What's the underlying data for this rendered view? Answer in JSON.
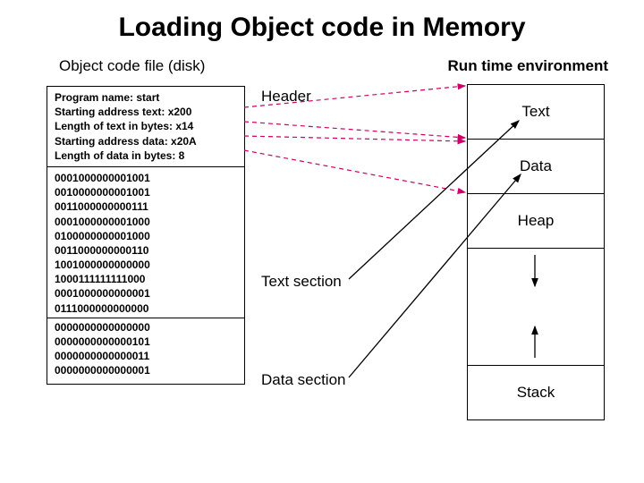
{
  "title": "Loading Object code in Memory",
  "left_heading": "Object code file (disk)",
  "right_heading": "Run time environment",
  "header_fields": {
    "line1": "Program name: start",
    "line2": "Starting address text: x200",
    "line3": "Length of text in bytes: x14",
    "line4": "Starting address data: x20A",
    "line5": "Length of data in bytes: 8"
  },
  "bits": {
    "text_rows": [
      "0001000000001001",
      "0010000000001001",
      "0011000000000111",
      "0001000000001000",
      "0100000000001000",
      "0011000000000110",
      "1001000000000000",
      "1000111111111000",
      "0001000000000001",
      "0111000000000000"
    ],
    "data_rows": [
      "0000000000000000",
      "0000000000000101",
      "0000000000000011",
      "0000000000000001"
    ]
  },
  "section_labels": {
    "header": "Header",
    "text": "Text section",
    "data": "Data section"
  },
  "mem_cells": {
    "text": "Text",
    "data": "Data",
    "heap": "Heap",
    "stack": "Stack"
  }
}
